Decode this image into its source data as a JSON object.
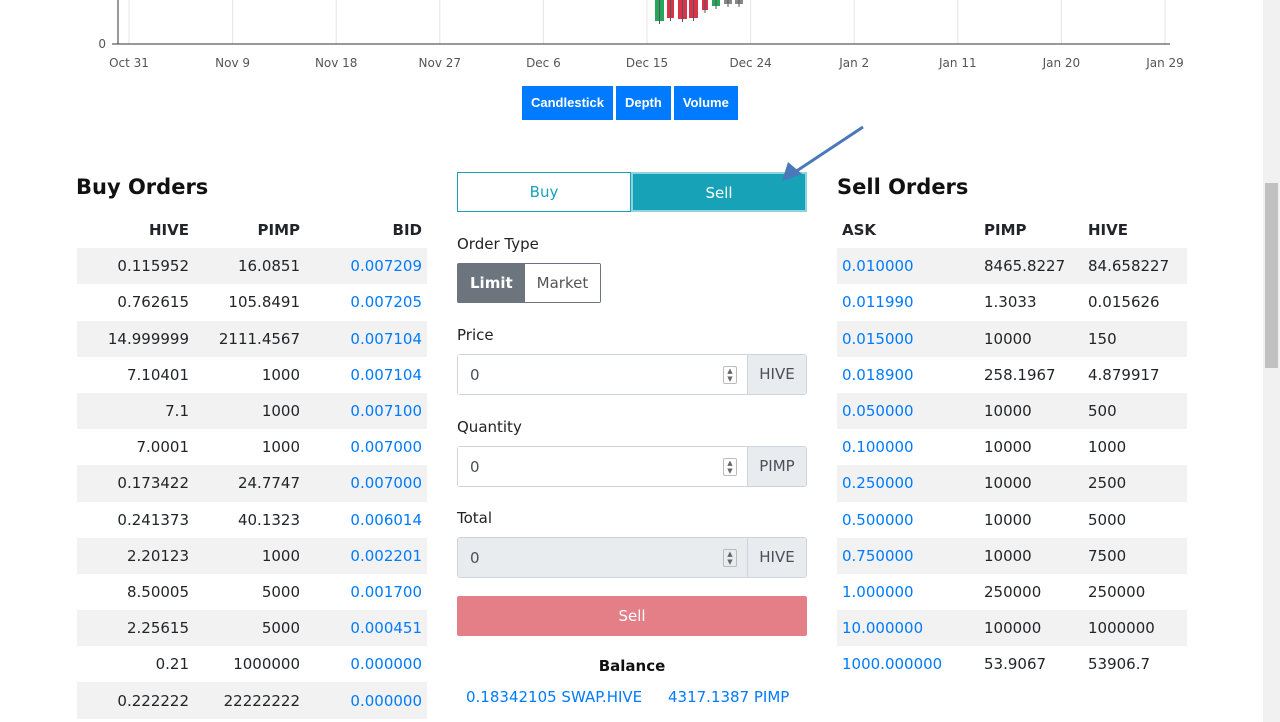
{
  "chart": {
    "x_ticks": [
      "Oct 31",
      "Nov 9",
      "Nov 18",
      "Nov 27",
      "Dec 6",
      "Dec 15",
      "Dec 24",
      "Jan 2",
      "Jan 11",
      "Jan 20",
      "Jan 29"
    ],
    "y_tick": "0",
    "buttons": [
      "Candlestick",
      "Depth",
      "Volume"
    ],
    "colors": {
      "up": "#26a65b",
      "down": "#d9334a",
      "button": "#007bff"
    }
  },
  "buy_orders": {
    "title": "Buy Orders",
    "headers": [
      "HIVE",
      "PIMP",
      "BID"
    ],
    "rows": [
      [
        "0.115952",
        "16.0851",
        "0.007209"
      ],
      [
        "0.762615",
        "105.8491",
        "0.007205"
      ],
      [
        "14.999999",
        "2111.4567",
        "0.007104"
      ],
      [
        "7.10401",
        "1000",
        "0.007104"
      ],
      [
        "7.1",
        "1000",
        "0.007100"
      ],
      [
        "7.0001",
        "1000",
        "0.007000"
      ],
      [
        "0.173422",
        "24.7747",
        "0.007000"
      ],
      [
        "0.241373",
        "40.1323",
        "0.006014"
      ],
      [
        "2.20123",
        "1000",
        "0.002201"
      ],
      [
        "8.50005",
        "5000",
        "0.001700"
      ],
      [
        "2.25615",
        "5000",
        "0.000451"
      ],
      [
        "0.21",
        "1000000",
        "0.000000"
      ],
      [
        "0.222222",
        "22222222",
        "0.000000"
      ]
    ]
  },
  "sell_orders": {
    "title": "Sell Orders",
    "headers": [
      "ASK",
      "PIMP",
      "HIVE"
    ],
    "rows": [
      [
        "0.010000",
        "8465.8227",
        "84.658227"
      ],
      [
        "0.011990",
        "1.3033",
        "0.015626"
      ],
      [
        "0.015000",
        "10000",
        "150"
      ],
      [
        "0.018900",
        "258.1967",
        "4.879917"
      ],
      [
        "0.050000",
        "10000",
        "500"
      ],
      [
        "0.100000",
        "10000",
        "1000"
      ],
      [
        "0.250000",
        "10000",
        "2500"
      ],
      [
        "0.500000",
        "10000",
        "5000"
      ],
      [
        "0.750000",
        "10000",
        "7500"
      ],
      [
        "1.000000",
        "250000",
        "250000"
      ],
      [
        "10.000000",
        "100000",
        "1000000"
      ],
      [
        "1000.000000",
        "53.9067",
        "53906.7"
      ]
    ]
  },
  "order_form": {
    "tab_buy": "Buy",
    "tab_sell": "Sell",
    "order_type_label": "Order Type",
    "type_limit": "Limit",
    "type_market": "Market",
    "price_label": "Price",
    "price_value": "0",
    "price_unit": "HIVE",
    "quantity_label": "Quantity",
    "quantity_value": "0",
    "quantity_unit": "PIMP",
    "total_label": "Total",
    "total_value": "0",
    "total_unit": "HIVE",
    "submit_label": "Sell",
    "balance_label": "Balance",
    "balance_hive": "0.18342105 SWAP.HIVE",
    "balance_pimp": "4317.1387 PIMP"
  }
}
